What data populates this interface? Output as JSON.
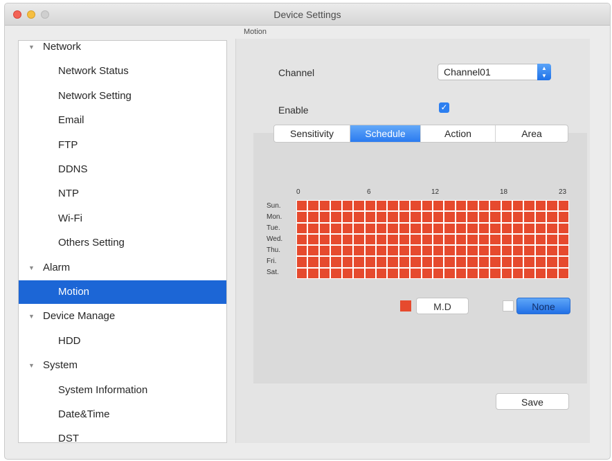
{
  "window": {
    "title": "Device Settings"
  },
  "sidebar": {
    "items": [
      {
        "label": "Network",
        "level": "group",
        "expanded": true
      },
      {
        "label": "Network Status",
        "level": "child"
      },
      {
        "label": "Network Setting",
        "level": "child"
      },
      {
        "label": "Email",
        "level": "child"
      },
      {
        "label": "FTP",
        "level": "child"
      },
      {
        "label": "DDNS",
        "level": "child"
      },
      {
        "label": "NTP",
        "level": "child"
      },
      {
        "label": "Wi-Fi",
        "level": "child"
      },
      {
        "label": "Others Setting",
        "level": "child"
      },
      {
        "label": "Alarm",
        "level": "group",
        "expanded": true
      },
      {
        "label": "Motion",
        "level": "child",
        "selected": true
      },
      {
        "label": "Device Manage",
        "level": "group",
        "expanded": true
      },
      {
        "label": "HDD",
        "level": "child"
      },
      {
        "label": "System",
        "level": "group",
        "expanded": true
      },
      {
        "label": "System Information",
        "level": "child"
      },
      {
        "label": "Date&Time",
        "level": "child"
      },
      {
        "label": "DST",
        "level": "child"
      }
    ]
  },
  "main": {
    "section_title": "Motion",
    "channel": {
      "label": "Channel",
      "value": "Channel01"
    },
    "enable": {
      "label": "Enable",
      "checked": true
    },
    "tabs": [
      {
        "label": "Sensitivity",
        "active": false
      },
      {
        "label": "Schedule",
        "active": true
      },
      {
        "label": "Action",
        "active": false
      },
      {
        "label": "Area",
        "active": false
      }
    ],
    "schedule": {
      "hour_labels": [
        "0",
        "6",
        "12",
        "18",
        "23"
      ],
      "days": [
        "Sun.",
        "Mon.",
        "Tue.",
        "Wed.",
        "Thu.",
        "Fri.",
        "Sat."
      ],
      "hours_per_day": 24,
      "all_selected": true,
      "legend": {
        "md_label": "M.D",
        "none_label": "None"
      },
      "md_color": "#e64a2e"
    },
    "save_label": "Save"
  },
  "colors": {
    "accent": "#1c66d6",
    "schedule_active": "#e64a2e"
  }
}
